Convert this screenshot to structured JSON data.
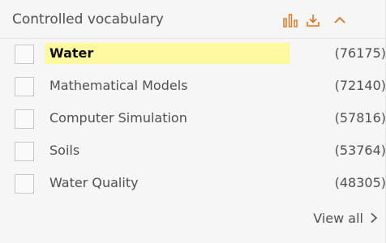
{
  "facet": {
    "title": "Controlled vocabulary",
    "icons": {
      "chart": "bar-chart-icon",
      "download": "download-icon",
      "collapse": "chevron-up-icon"
    },
    "accent_color": "#e9711c",
    "highlight_color": "#fffaa0",
    "items": [
      {
        "label": "Water",
        "count": "(76175)",
        "checked": false,
        "highlighted": true
      },
      {
        "label": "Mathematical Models",
        "count": "(72140)",
        "checked": false,
        "highlighted": false
      },
      {
        "label": "Computer Simulation",
        "count": "(57816)",
        "checked": false,
        "highlighted": false
      },
      {
        "label": "Soils",
        "count": "(53764)",
        "checked": false,
        "highlighted": false
      },
      {
        "label": "Water Quality",
        "count": "(48305)",
        "checked": false,
        "highlighted": false
      }
    ],
    "view_all_label": "View all"
  }
}
